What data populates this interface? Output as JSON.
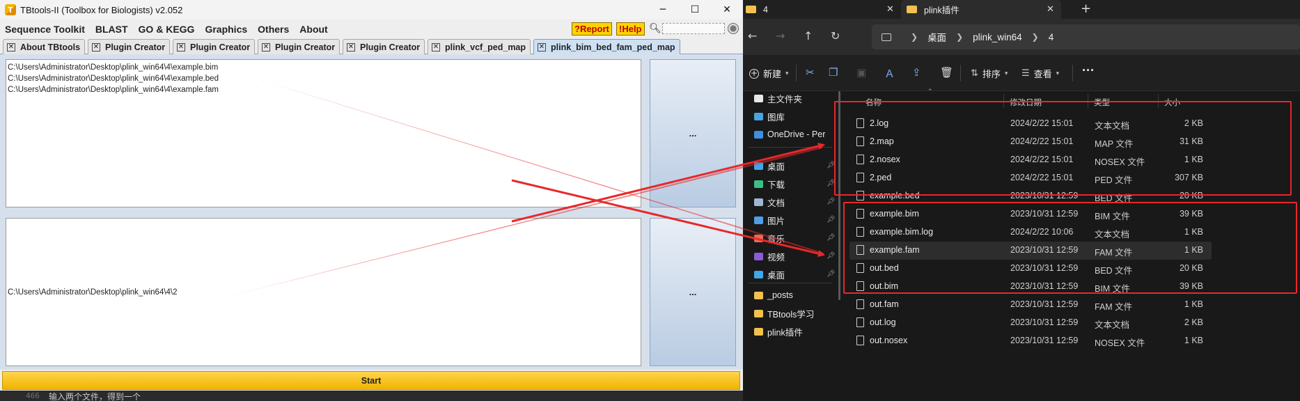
{
  "tbtools": {
    "title": "TBtools-II (Toolbox for Biologists) v2.052",
    "menu": [
      "Sequence Toolkit",
      "BLAST",
      "GO & KEGG",
      "Graphics",
      "Others",
      "About"
    ],
    "report": "?Report",
    "help": "!Help",
    "tabs": [
      "About TBtools",
      "Plugin Creator",
      "Plugin Creator",
      "Plugin Creator",
      "Plugin Creator",
      "plink_vcf_ped_map",
      "plink_bim_bed_fam_ped_map"
    ],
    "input_text": "C:\\Users\\Administrator\\Desktop\\plink_win64\\4\\example.bim\nC:\\Users\\Administrator\\Desktop\\plink_win64\\4\\example.bed\nC:\\Users\\Administrator\\Desktop\\plink_win64\\4\\example.fam",
    "output_text": "C:\\Users\\Administrator\\Desktop\\plink_win64\\4\\2",
    "browse_label": "...",
    "start_label": "Start",
    "bottom_line_no": "466",
    "bottom_text": "输入两个文件，得到一个"
  },
  "explorer": {
    "tab1": "4",
    "tab2": "plink插件",
    "breadcrumb": [
      "桌面",
      "plink_win64",
      "4"
    ],
    "toolbar": {
      "new": "新建",
      "sort": "排序",
      "view": "查看",
      "more": "···"
    },
    "columns": [
      "名称",
      "修改日期",
      "类型",
      "大小"
    ],
    "sidebar": [
      {
        "label": "主文件夹",
        "icon": "home-icon",
        "pinned": false
      },
      {
        "label": "图库",
        "icon": "gallery-icon",
        "pinned": false
      },
      {
        "label": "OneDrive - Per",
        "icon": "cloud-icon",
        "pinned": false
      },
      {
        "label": "桌面",
        "icon": "desktop-icon",
        "pinned": true
      },
      {
        "label": "下载",
        "icon": "download-icon",
        "pinned": true
      },
      {
        "label": "文档",
        "icon": "document-icon",
        "pinned": true
      },
      {
        "label": "图片",
        "icon": "picture-icon",
        "pinned": true
      },
      {
        "label": "音乐",
        "icon": "music-icon",
        "pinned": true
      },
      {
        "label": "视频",
        "icon": "video-icon",
        "pinned": true
      },
      {
        "label": "桌面",
        "icon": "desktop-icon",
        "pinned": true
      },
      {
        "label": "_posts",
        "icon": "folder-icon",
        "pinned": false
      },
      {
        "label": "TBtools学习",
        "icon": "folder-icon",
        "pinned": false
      },
      {
        "label": "plink插件",
        "icon": "folder-icon",
        "pinned": false
      }
    ],
    "files": [
      {
        "name": "2.log",
        "date": "2024/2/22 15:01",
        "type": "文本文档",
        "size": "2 KB"
      },
      {
        "name": "2.map",
        "date": "2024/2/22 15:01",
        "type": "MAP 文件",
        "size": "31 KB"
      },
      {
        "name": "2.nosex",
        "date": "2024/2/22 15:01",
        "type": "NOSEX 文件",
        "size": "1 KB"
      },
      {
        "name": "2.ped",
        "date": "2024/2/22 15:01",
        "type": "PED 文件",
        "size": "307 KB"
      },
      {
        "name": "example.bed",
        "date": "2023/10/31 12:59",
        "type": "BED 文件",
        "size": "20 KB"
      },
      {
        "name": "example.bim",
        "date": "2023/10/31 12:59",
        "type": "BIM 文件",
        "size": "39 KB"
      },
      {
        "name": "example.bim.log",
        "date": "2024/2/22 10:06",
        "type": "文本文档",
        "size": "1 KB"
      },
      {
        "name": "example.fam",
        "date": "2023/10/31 12:59",
        "type": "FAM 文件",
        "size": "1 KB"
      },
      {
        "name": "out.bed",
        "date": "2023/10/31 12:59",
        "type": "BED 文件",
        "size": "20 KB"
      },
      {
        "name": "out.bim",
        "date": "2023/10/31 12:59",
        "type": "BIM 文件",
        "size": "39 KB"
      },
      {
        "name": "out.fam",
        "date": "2023/10/31 12:59",
        "type": "FAM 文件",
        "size": "1 KB"
      },
      {
        "name": "out.log",
        "date": "2023/10/31 12:59",
        "type": "文本文档",
        "size": "2 KB"
      },
      {
        "name": "out.nosex",
        "date": "2023/10/31 12:59",
        "type": "NOSEX 文件",
        "size": "1 KB"
      }
    ],
    "highlighted_file": "example.fam"
  },
  "colors": {
    "annotation_red": "#e8282a",
    "start_button": "#f0b400",
    "explorer_bg": "#191919"
  }
}
